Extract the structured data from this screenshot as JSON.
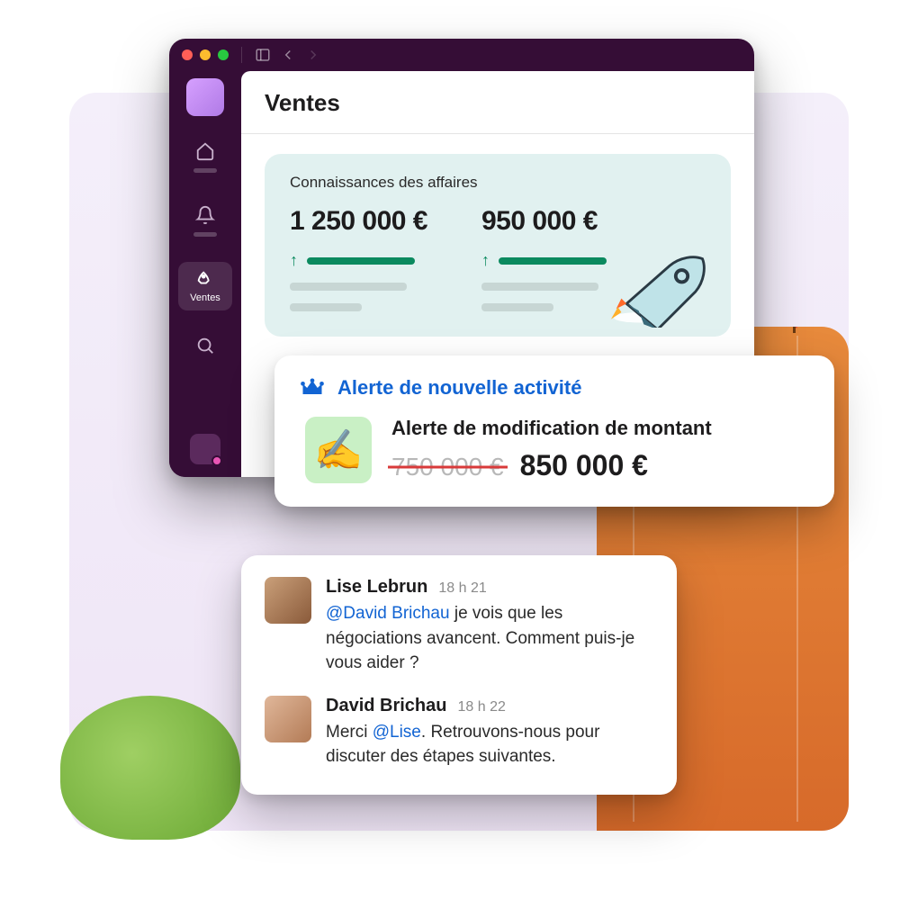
{
  "sidebar": {
    "active_label": "Ventes"
  },
  "header": {
    "title": "Ventes"
  },
  "metrics": {
    "card_title": "Connaissances des affaires",
    "items": [
      {
        "value": "1 250 000 €"
      },
      {
        "value": "950 000 €"
      }
    ]
  },
  "alert": {
    "header": "Alerte de nouvelle activité",
    "icon_emoji": "✍️",
    "subtitle": "Alerte de modification de montant",
    "old_amount": "750 000 €",
    "new_amount": "850 000 €"
  },
  "chat": [
    {
      "name": "Lise Lebrun",
      "time": "18 h 21",
      "mention": "@David Brichau",
      "text_before": "",
      "text_after": " je vois que les négociations avancent. Comment puis-je vous aider ?"
    },
    {
      "name": "David Brichau",
      "time": "18 h 22",
      "mention": "@Lise",
      "text_before": "Merci ",
      "text_after": ". Retrouvons-nous pour discuter des étapes suivantes."
    }
  ]
}
